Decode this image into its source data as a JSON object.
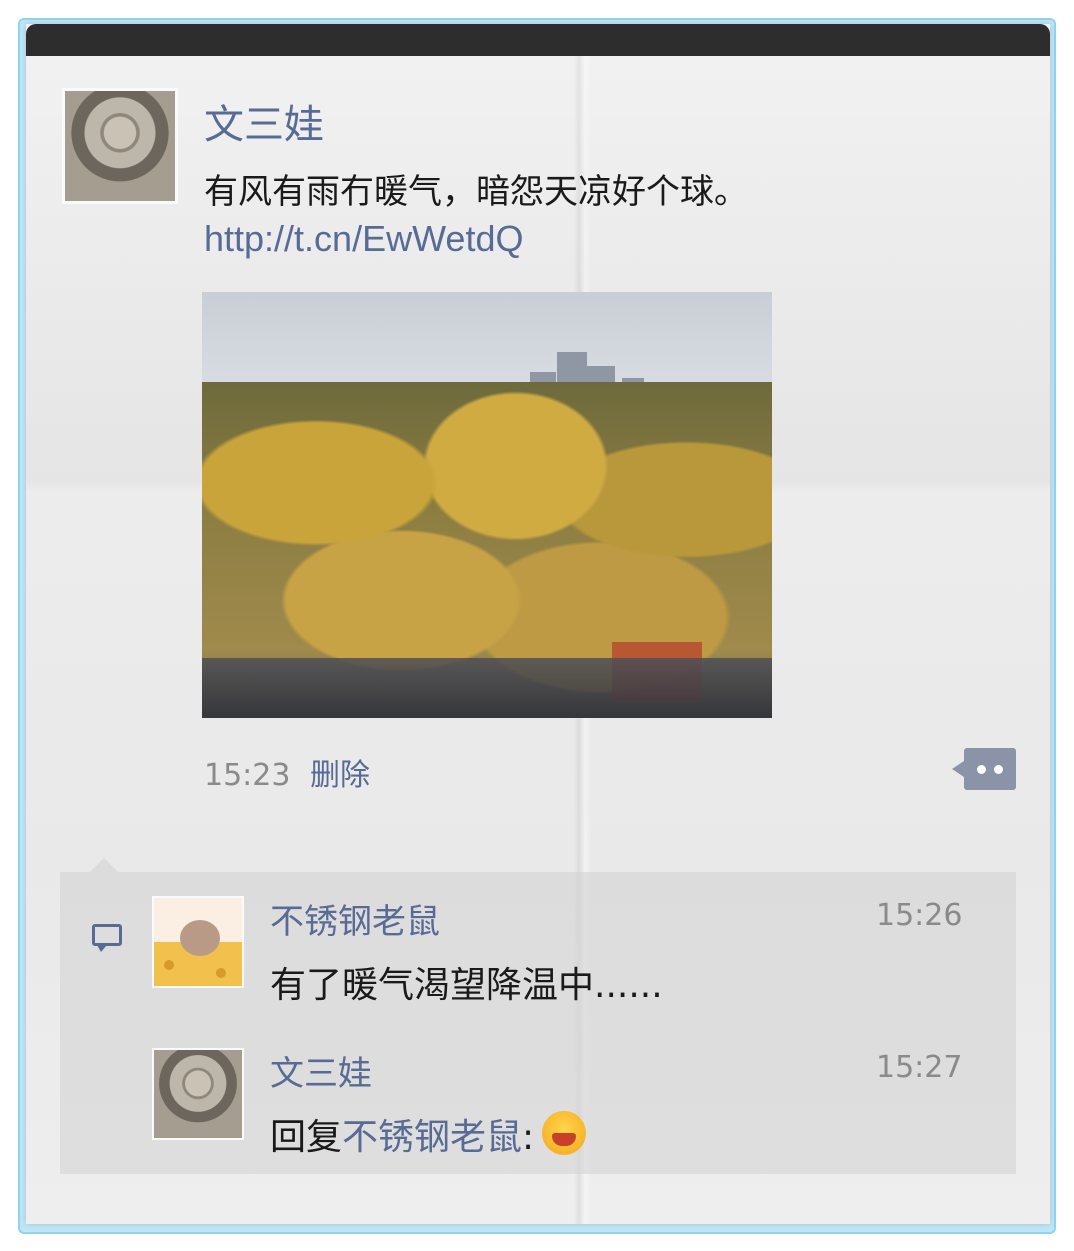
{
  "post": {
    "author": "文三娃",
    "text": "有风有雨冇暖气，暗怨天凉好个球。",
    "link": "http://t.cn/EwWetdQ",
    "time": "15:23",
    "delete_label": "删除"
  },
  "comments": [
    {
      "author": "不锈钢老鼠",
      "time": "15:26",
      "text": "有了暖气渴望降温中......"
    },
    {
      "author": "文三娃",
      "time": "15:27",
      "reply_prefix": "回复",
      "reply_to": "不锈钢老鼠",
      "reply_sep": ":",
      "emoji": "angry-laugh-emoji"
    }
  ],
  "icons": {
    "more": "more-dots-icon",
    "comment": "comment-bubble-icon"
  },
  "colors": {
    "link": "#576b95",
    "time": "#8a8a8a",
    "text": "#1a1a1a"
  }
}
